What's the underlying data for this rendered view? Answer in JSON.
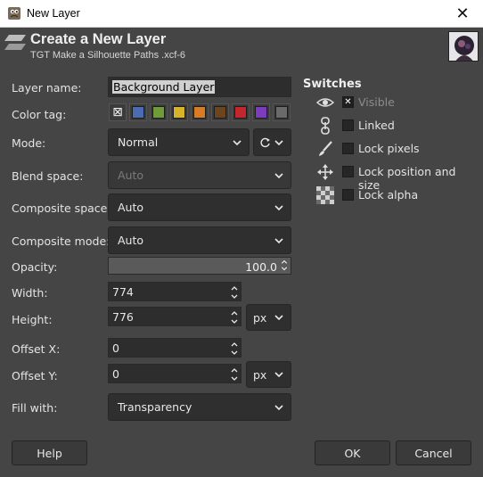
{
  "window": {
    "title": "New Layer",
    "close_glyph": "✕"
  },
  "header": {
    "title": "Create a New Layer",
    "subtitle": "TGT Make a Silhouette Paths .xcf-6"
  },
  "form": {
    "layer_name_label": "Layer name:",
    "layer_name_value": "Background Layer",
    "color_tag_label": "Color tag:",
    "color_tag_none_glyph": "⊠",
    "color_tags": [
      "#4c6bb0",
      "#6f9b3a",
      "#d6b32a",
      "#d77b25",
      "#6b4420",
      "#c2272d",
      "#7c3dbd",
      "#6a6a6a"
    ],
    "mode_label": "Mode:",
    "mode_value": "Normal",
    "blend_space_label": "Blend space:",
    "blend_space_value": "Auto",
    "composite_space_label": "Composite space:",
    "composite_space_value": "Auto",
    "composite_mode_label": "Composite mode:",
    "composite_mode_value": "Auto",
    "opacity_label": "Opacity:",
    "opacity_value": "100.0",
    "width_label": "Width:",
    "width_value": "774",
    "height_label": "Height:",
    "height_value": "776",
    "size_unit": "px",
    "offset_x_label": "Offset X:",
    "offset_x_value": "0",
    "offset_y_label": "Offset Y:",
    "offset_y_value": "0",
    "offset_unit": "px",
    "fill_label": "Fill with:",
    "fill_value": "Transparency"
  },
  "switches": {
    "title": "Switches",
    "visible_label": "Visible",
    "visible_checked_glyph": "✕",
    "linked_label": "Linked",
    "lock_pixels_label": "Lock pixels",
    "lock_position_label": "Lock position and size",
    "lock_alpha_label": "Lock alpha"
  },
  "buttons": {
    "help": "Help",
    "ok": "OK",
    "cancel": "Cancel"
  }
}
